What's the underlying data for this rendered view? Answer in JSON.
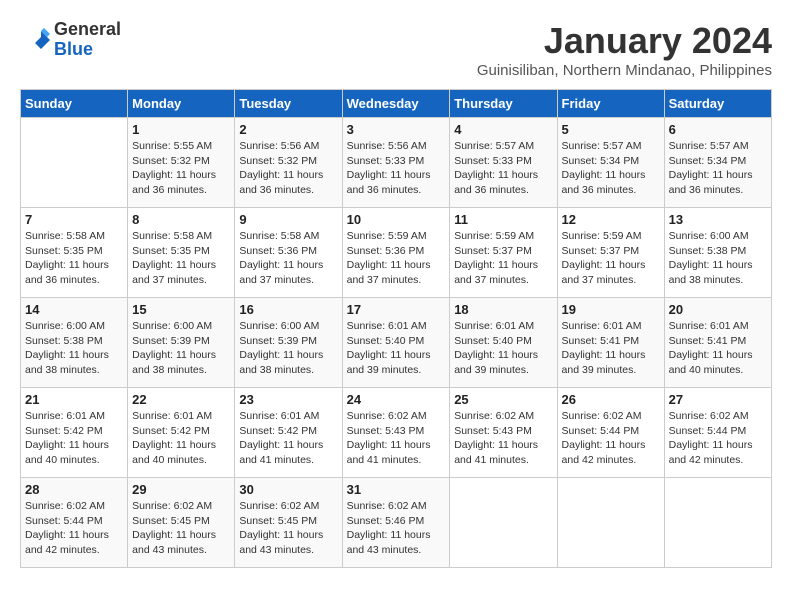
{
  "header": {
    "logo_general": "General",
    "logo_blue": "Blue",
    "month_title": "January 2024",
    "location": "Guinisiliban, Northern Mindanao, Philippines"
  },
  "days_of_week": [
    "Sunday",
    "Monday",
    "Tuesday",
    "Wednesday",
    "Thursday",
    "Friday",
    "Saturday"
  ],
  "weeks": [
    [
      {
        "day": "",
        "info": ""
      },
      {
        "day": "1",
        "info": "Sunrise: 5:55 AM\nSunset: 5:32 PM\nDaylight: 11 hours\nand 36 minutes."
      },
      {
        "day": "2",
        "info": "Sunrise: 5:56 AM\nSunset: 5:32 PM\nDaylight: 11 hours\nand 36 minutes."
      },
      {
        "day": "3",
        "info": "Sunrise: 5:56 AM\nSunset: 5:33 PM\nDaylight: 11 hours\nand 36 minutes."
      },
      {
        "day": "4",
        "info": "Sunrise: 5:57 AM\nSunset: 5:33 PM\nDaylight: 11 hours\nand 36 minutes."
      },
      {
        "day": "5",
        "info": "Sunrise: 5:57 AM\nSunset: 5:34 PM\nDaylight: 11 hours\nand 36 minutes."
      },
      {
        "day": "6",
        "info": "Sunrise: 5:57 AM\nSunset: 5:34 PM\nDaylight: 11 hours\nand 36 minutes."
      }
    ],
    [
      {
        "day": "7",
        "info": "Sunrise: 5:58 AM\nSunset: 5:35 PM\nDaylight: 11 hours\nand 36 minutes."
      },
      {
        "day": "8",
        "info": "Sunrise: 5:58 AM\nSunset: 5:35 PM\nDaylight: 11 hours\nand 37 minutes."
      },
      {
        "day": "9",
        "info": "Sunrise: 5:58 AM\nSunset: 5:36 PM\nDaylight: 11 hours\nand 37 minutes."
      },
      {
        "day": "10",
        "info": "Sunrise: 5:59 AM\nSunset: 5:36 PM\nDaylight: 11 hours\nand 37 minutes."
      },
      {
        "day": "11",
        "info": "Sunrise: 5:59 AM\nSunset: 5:37 PM\nDaylight: 11 hours\nand 37 minutes."
      },
      {
        "day": "12",
        "info": "Sunrise: 5:59 AM\nSunset: 5:37 PM\nDaylight: 11 hours\nand 37 minutes."
      },
      {
        "day": "13",
        "info": "Sunrise: 6:00 AM\nSunset: 5:38 PM\nDaylight: 11 hours\nand 38 minutes."
      }
    ],
    [
      {
        "day": "14",
        "info": "Sunrise: 6:00 AM\nSunset: 5:38 PM\nDaylight: 11 hours\nand 38 minutes."
      },
      {
        "day": "15",
        "info": "Sunrise: 6:00 AM\nSunset: 5:39 PM\nDaylight: 11 hours\nand 38 minutes."
      },
      {
        "day": "16",
        "info": "Sunrise: 6:00 AM\nSunset: 5:39 PM\nDaylight: 11 hours\nand 38 minutes."
      },
      {
        "day": "17",
        "info": "Sunrise: 6:01 AM\nSunset: 5:40 PM\nDaylight: 11 hours\nand 39 minutes."
      },
      {
        "day": "18",
        "info": "Sunrise: 6:01 AM\nSunset: 5:40 PM\nDaylight: 11 hours\nand 39 minutes."
      },
      {
        "day": "19",
        "info": "Sunrise: 6:01 AM\nSunset: 5:41 PM\nDaylight: 11 hours\nand 39 minutes."
      },
      {
        "day": "20",
        "info": "Sunrise: 6:01 AM\nSunset: 5:41 PM\nDaylight: 11 hours\nand 40 minutes."
      }
    ],
    [
      {
        "day": "21",
        "info": "Sunrise: 6:01 AM\nSunset: 5:42 PM\nDaylight: 11 hours\nand 40 minutes."
      },
      {
        "day": "22",
        "info": "Sunrise: 6:01 AM\nSunset: 5:42 PM\nDaylight: 11 hours\nand 40 minutes."
      },
      {
        "day": "23",
        "info": "Sunrise: 6:01 AM\nSunset: 5:42 PM\nDaylight: 11 hours\nand 41 minutes."
      },
      {
        "day": "24",
        "info": "Sunrise: 6:02 AM\nSunset: 5:43 PM\nDaylight: 11 hours\nand 41 minutes."
      },
      {
        "day": "25",
        "info": "Sunrise: 6:02 AM\nSunset: 5:43 PM\nDaylight: 11 hours\nand 41 minutes."
      },
      {
        "day": "26",
        "info": "Sunrise: 6:02 AM\nSunset: 5:44 PM\nDaylight: 11 hours\nand 42 minutes."
      },
      {
        "day": "27",
        "info": "Sunrise: 6:02 AM\nSunset: 5:44 PM\nDaylight: 11 hours\nand 42 minutes."
      }
    ],
    [
      {
        "day": "28",
        "info": "Sunrise: 6:02 AM\nSunset: 5:44 PM\nDaylight: 11 hours\nand 42 minutes."
      },
      {
        "day": "29",
        "info": "Sunrise: 6:02 AM\nSunset: 5:45 PM\nDaylight: 11 hours\nand 43 minutes."
      },
      {
        "day": "30",
        "info": "Sunrise: 6:02 AM\nSunset: 5:45 PM\nDaylight: 11 hours\nand 43 minutes."
      },
      {
        "day": "31",
        "info": "Sunrise: 6:02 AM\nSunset: 5:46 PM\nDaylight: 11 hours\nand 43 minutes."
      },
      {
        "day": "",
        "info": ""
      },
      {
        "day": "",
        "info": ""
      },
      {
        "day": "",
        "info": ""
      }
    ]
  ]
}
